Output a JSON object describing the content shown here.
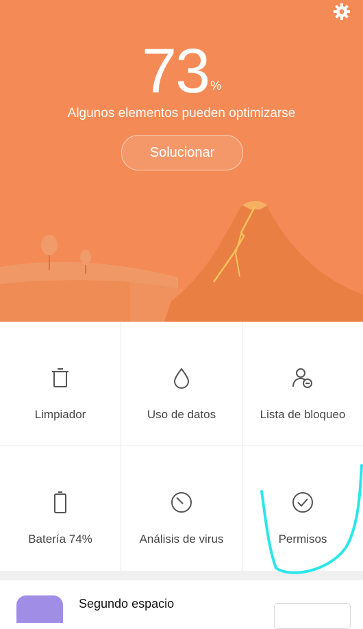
{
  "header": {
    "score": "73",
    "score_unit": "%",
    "subtitle": "Algunos elementos pueden optimizarse",
    "fix_button": "Solucionar",
    "settings_icon": "gear-icon"
  },
  "tools": [
    {
      "label": "Limpiador",
      "icon": "trash-icon"
    },
    {
      "label": "Uso de datos",
      "icon": "water-drop-icon"
    },
    {
      "label": "Lista de bloqueo",
      "icon": "user-block-icon"
    },
    {
      "label": "Batería 74%",
      "icon": "battery-icon"
    },
    {
      "label": "Análisis de virus",
      "icon": "scan-icon"
    },
    {
      "label": "Permisos",
      "icon": "check-circle-icon"
    }
  ],
  "card": {
    "title": "Segundo espacio"
  },
  "colors": {
    "hero": "#f48a55",
    "annotation": "#2be6ea"
  }
}
